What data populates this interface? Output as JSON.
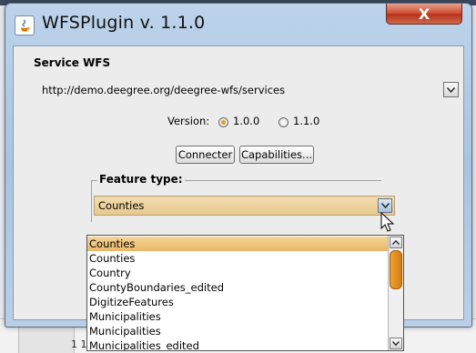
{
  "window": {
    "title": "WFSPlugin v. 1.1.0",
    "close_glyph": "X",
    "app_icon": "java-icon"
  },
  "service": {
    "legend": "Service WFS",
    "url": "http://demo.deegree.org/deegree-wfs/services"
  },
  "version": {
    "label": "Version:",
    "options": [
      "1.0.0",
      "1.1.0"
    ],
    "selected": "1.0.0"
  },
  "buttons": {
    "connect": "Connecter",
    "capabilities": "Capabilities..."
  },
  "feature_type": {
    "legend": "Feature type:",
    "selected": "Counties",
    "options": [
      "Counties",
      "Counties",
      "Country",
      "CountyBoundaries_edited",
      "DigitizeFeatures",
      "Municipalities",
      "Municipalities",
      "Municipalities_edited"
    ]
  },
  "background": {
    "row_number": "1 1"
  },
  "colors": {
    "selection": "#f0c87a",
    "radio_on": "#e0a020",
    "close_button": "#c9472d",
    "scroll_thumb": "#e89020"
  }
}
